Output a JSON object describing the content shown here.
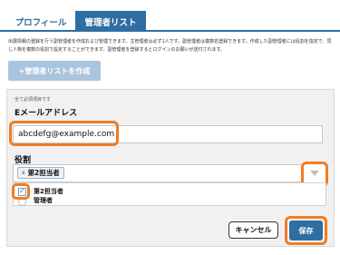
{
  "tabs": [
    {
      "label": "プロフィール"
    },
    {
      "label": "管理者リスト"
    }
  ],
  "description": "出展情報の登録を行う副管理者を作成および管理できます。主管理者は必ず1人です。副管理者は複数名登録できます。作成した副管理者には役割を指定で、同じ人物を複数の役割で設定することができます。副管理者を登録するとログインのお願いが送付されます。",
  "create_button": {
    "label": "+管理者リストを作成"
  },
  "form": {
    "required_note": "全て必須項目です",
    "email_label": "Eメールアドレス",
    "email_value": "abcdefg@example.com",
    "role_label": "役割",
    "selected_tag": {
      "remove": "x",
      "label": "第2担当者"
    },
    "options": [
      {
        "label": "第2担当者",
        "checked": true
      },
      {
        "label": "管理者",
        "checked": false
      }
    ],
    "cancel_label": "キャンセル",
    "save_label": "保存"
  },
  "colors": {
    "accent": "#2f6ea3",
    "highlight": "#f07d22"
  }
}
